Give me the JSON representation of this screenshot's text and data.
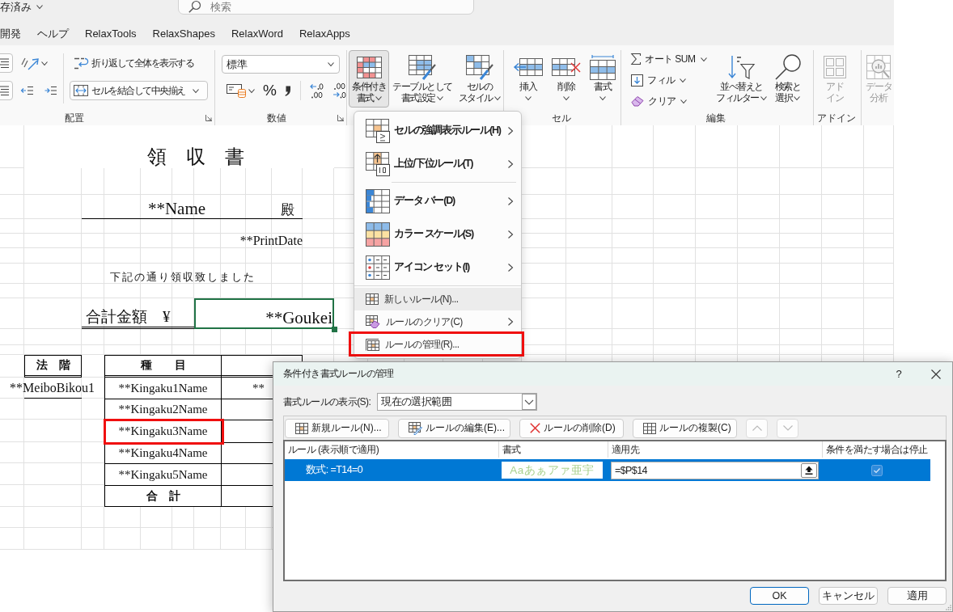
{
  "title_bar": {
    "save_status": "存済み",
    "search": {
      "placeholder": "検索"
    }
  },
  "ribbon_tabs": [
    {
      "label": "開発"
    },
    {
      "label": "ヘルプ"
    },
    {
      "label": "RelaxTools"
    },
    {
      "label": "RelaxShapes"
    },
    {
      "label": "RelaxWord"
    },
    {
      "label": "RelaxApps"
    }
  ],
  "ribbon": {
    "alignment": {
      "label": "配置",
      "wrap_text": "折り返して全体を表示する",
      "merge_center": "セルを結合して中央揃え"
    },
    "number": {
      "label": "数値",
      "format": "標準",
      "percent": "%"
    },
    "styles": {
      "buttons": [
        {
          "lines": [
            "条件付き",
            "書式"
          ],
          "pressed": true,
          "menu": true
        },
        {
          "lines": [
            "テーブルとして",
            "書式設定"
          ],
          "pressed": false,
          "menu": true
        },
        {
          "lines": [
            "セルの",
            "スタイル"
          ],
          "pressed": false,
          "menu": true
        }
      ]
    },
    "cells": {
      "label": "セル",
      "buttons": [
        {
          "lines": [
            "挿入"
          ],
          "menu": true
        },
        {
          "lines": [
            "削除"
          ],
          "menu": true
        },
        {
          "lines": [
            "書式"
          ],
          "menu": true
        }
      ]
    },
    "editing": {
      "label": "編集",
      "small_buttons": [
        {
          "label": "オート SUM"
        },
        {
          "label": "フィル"
        },
        {
          "label": "クリア"
        }
      ],
      "buttons": [
        {
          "lines": [
            "並べ替えと",
            "フィルター"
          ],
          "menu": true
        },
        {
          "lines": [
            "検索と",
            "選択"
          ],
          "menu": true
        }
      ]
    },
    "addins": {
      "label": "アドイン",
      "buttons": [
        {
          "lines": [
            "アド",
            "イン"
          ],
          "disabled": true
        }
      ]
    },
    "analysis": {
      "buttons": [
        {
          "lines": [
            "データ",
            "分析"
          ],
          "disabled": true
        }
      ]
    }
  },
  "sheet": {
    "title": "領　収　書",
    "recipient": "**Name",
    "honorific": "殿",
    "print_date": "**PrintDate",
    "message": "下記の通り領収致しました",
    "total": {
      "label": "合計金額　¥",
      "value": "**Goukei",
      "active": true
    },
    "category": {
      "header": "法　階",
      "value": "**MeiboBikou1"
    },
    "items": {
      "header": "種　　目",
      "rows": [
        {
          "name": "**Kingaku1Name",
          "value": "**",
          "marked": false
        },
        {
          "name": "**Kingaku2Name",
          "marked": false
        },
        {
          "name": "**Kingaku3Name",
          "marked": true
        },
        {
          "name": "**Kingaku4Name",
          "marked": false
        },
        {
          "name": "**Kingaku5Name",
          "marked": false
        }
      ],
      "total_label": "合　計"
    }
  },
  "format_menu": {
    "sections": [
      {
        "kind": "large",
        "items": [
          {
            "label": "セルの強調表示ルール(H)",
            "submenu": true,
            "hovered": false,
            "marked": false
          },
          {
            "label": "上位/下位ルール(T)",
            "submenu": true,
            "hovered": false,
            "marked": false
          }
        ]
      },
      {
        "kind": "large",
        "items": [
          {
            "label": "データ バー(D)",
            "submenu": true,
            "hovered": false,
            "marked": false
          },
          {
            "label": "カラー スケール(S)",
            "submenu": true,
            "hovered": false,
            "marked": false
          },
          {
            "label": "アイコン セット(I)",
            "submenu": true,
            "hovered": false,
            "marked": false
          }
        ]
      },
      {
        "kind": "small",
        "items": [
          {
            "label": "新しいルール(N)...",
            "submenu": false,
            "hovered": true,
            "marked": false
          },
          {
            "label": "ルールのクリア(C)",
            "submenu": true,
            "hovered": false,
            "marked": false
          },
          {
            "label": "ルールの管理(R)...",
            "submenu": false,
            "hovered": false,
            "marked": true
          }
        ]
      }
    ]
  },
  "rules_dialog": {
    "title": "条件付き書式ルールの管理",
    "help": "?",
    "scope": {
      "label": "書式ルールの表示(S):",
      "value": "現在の選択範囲"
    },
    "toolbar": [
      {
        "label": "新規ルール(N)..."
      },
      {
        "label": "ルールの編集(E)..."
      },
      {
        "label": "ルールの削除(D)"
      },
      {
        "label": "ルールの複製(C)"
      }
    ],
    "move_up": {
      "disabled": true
    },
    "move_down": {
      "disabled": true
    },
    "columns": [
      "ルール (表示順で適用)",
      "書式",
      "適用先",
      "条件を満たす場合は停止"
    ],
    "rules": [
      {
        "rule": "数式: =T14=0",
        "preview": "Aaあぁアァ亜宇",
        "applies_to": "=$P$14",
        "stop_if_true": true,
        "selected": true
      }
    ],
    "buttons": [
      {
        "label": "OK",
        "default": true
      },
      {
        "label": "キャンセル",
        "default": false
      },
      {
        "label": "適用",
        "default": false
      }
    ]
  }
}
